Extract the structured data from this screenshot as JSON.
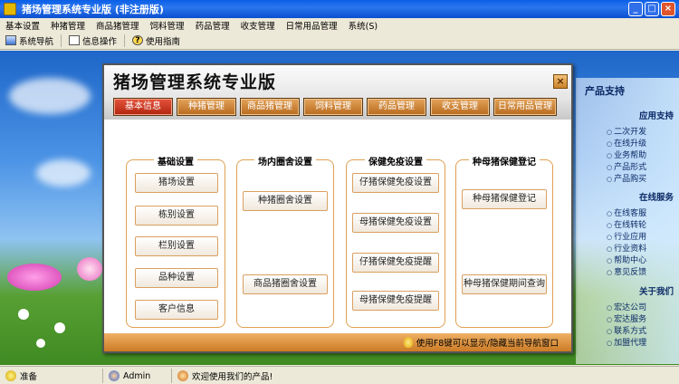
{
  "window": {
    "title": "猪场管理系统专业版 (非注册版)",
    "buttons": [
      "_",
      "□",
      "×"
    ]
  },
  "menu": [
    "基本设置",
    "种猪管理",
    "商品猪管理",
    "饲料管理",
    "药品管理",
    "收支管理",
    "日常用品管理",
    "系统(S)"
  ],
  "toolbar": {
    "nav": "系统导航",
    "info": "信息操作",
    "help": "使用指南"
  },
  "inner": {
    "title": "猪场管理系统专业版",
    "close": "×",
    "tabs": [
      "基本信息",
      "种猪管理",
      "商品猪管理",
      "饲料管理",
      "药品管理",
      "收支管理",
      "日常用品管理"
    ],
    "groups": {
      "basic": {
        "title": "基础设置",
        "buttons": [
          "猪场设置",
          "栋别设置",
          "栏别设置",
          "品种设置",
          "客户信息"
        ]
      },
      "pen": {
        "title": "场内圈舍设置",
        "buttons": [
          "种猪圈舍设置",
          "商品猪圈舍设置"
        ]
      },
      "health": {
        "title": "保健免疫设置",
        "buttons": [
          "仔猪保健免疫设置",
          "母猪保健免疫设置",
          "仔猪保健免疫提醒",
          "母猪保健免疫提醒"
        ]
      },
      "sow": {
        "title": "种母猪保健登记",
        "buttons": [
          "种母猪保健登记",
          "种母猪保健期间查询"
        ]
      }
    },
    "footer": "使用F8键可以显示/隐藏当前导航窗口"
  },
  "rightpanel": {
    "title": "产品支持",
    "sections": [
      {
        "title": "应用支持",
        "items": [
          "二次开发",
          "在线升级",
          "业务帮助",
          "产品形式",
          "产品购买"
        ]
      },
      {
        "title": "在线服务",
        "items": [
          "在线客服",
          "在线转轮",
          "行业应用",
          "行业资料",
          "帮助中心",
          "意见反馈"
        ]
      },
      {
        "title": "关于我们",
        "items": [
          "宏达公司",
          "宏达服务",
          "联系方式",
          "加盟代理"
        ]
      }
    ]
  },
  "statusbar": {
    "status": "准备",
    "user": "Admin",
    "welcome": "欢迎使用我们的产品!"
  },
  "colors": {
    "titlebar": "#0a5fe6",
    "tab": "#c47a2a",
    "tab_active": "#c83a22",
    "group_border": "#e0a050"
  }
}
